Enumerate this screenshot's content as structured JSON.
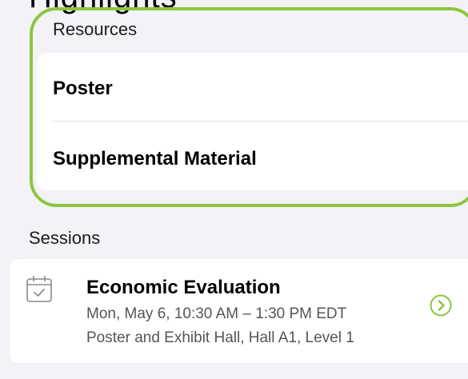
{
  "header": {
    "cut_heading": "Highlights"
  },
  "resources": {
    "label": "Resources",
    "items": [
      {
        "label": "Poster"
      },
      {
        "label": "Supplemental Material"
      }
    ]
  },
  "sessions": {
    "label": "Sessions",
    "items": [
      {
        "title": "Economic Evaluation",
        "time": "Mon, May 6, 10:30 AM – 1:30 PM EDT",
        "location": "Poster and Exhibit Hall, Hall A1, Level 1",
        "icon": "calendar-check-icon",
        "action_icon": "chevron-right-circle-icon"
      }
    ]
  },
  "colors": {
    "highlight": "#8cc63f",
    "background": "#f2f2f7",
    "card": "#ffffff"
  }
}
